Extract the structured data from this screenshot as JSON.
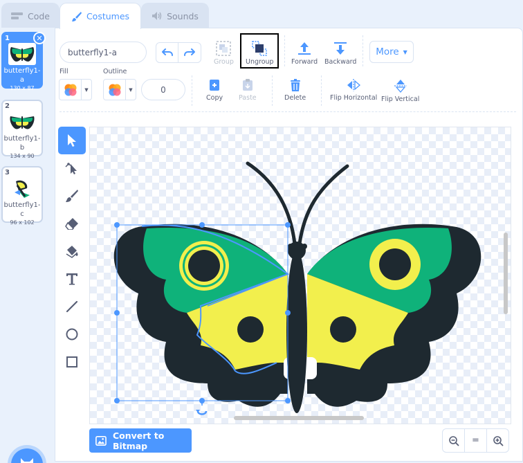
{
  "tabs": {
    "code": "Code",
    "costumes": "Costumes",
    "sounds": "Sounds"
  },
  "costumes": [
    {
      "index": "1",
      "name": "butterfly1-a",
      "size": "130 x 87",
      "selected": true
    },
    {
      "index": "2",
      "name": "butterfly1-b",
      "size": "134 x 90",
      "selected": false
    },
    {
      "index": "3",
      "name": "butterfly1-c",
      "size": "96 x 102",
      "selected": false
    }
  ],
  "editor": {
    "costume_name": "butterfly1-a",
    "group_label": "Group",
    "ungroup_label": "Ungroup",
    "forward_label": "Forward",
    "backward_label": "Backward",
    "more_label": "More",
    "fill_label": "Fill",
    "outline_label": "Outline",
    "outline_width": "0",
    "copy_label": "Copy",
    "paste_label": "Paste",
    "delete_label": "Delete",
    "flip_h_label": "Flip Horizontal",
    "flip_v_label": "Flip Vertical",
    "convert_label": "Convert to Bitmap",
    "zoom_reset": "="
  },
  "colors": {
    "accent": "#4c97ff",
    "butterfly_green": "#0fb27a",
    "butterfly_yellow": "#f2ef4d",
    "butterfly_dark": "#1e2930"
  }
}
